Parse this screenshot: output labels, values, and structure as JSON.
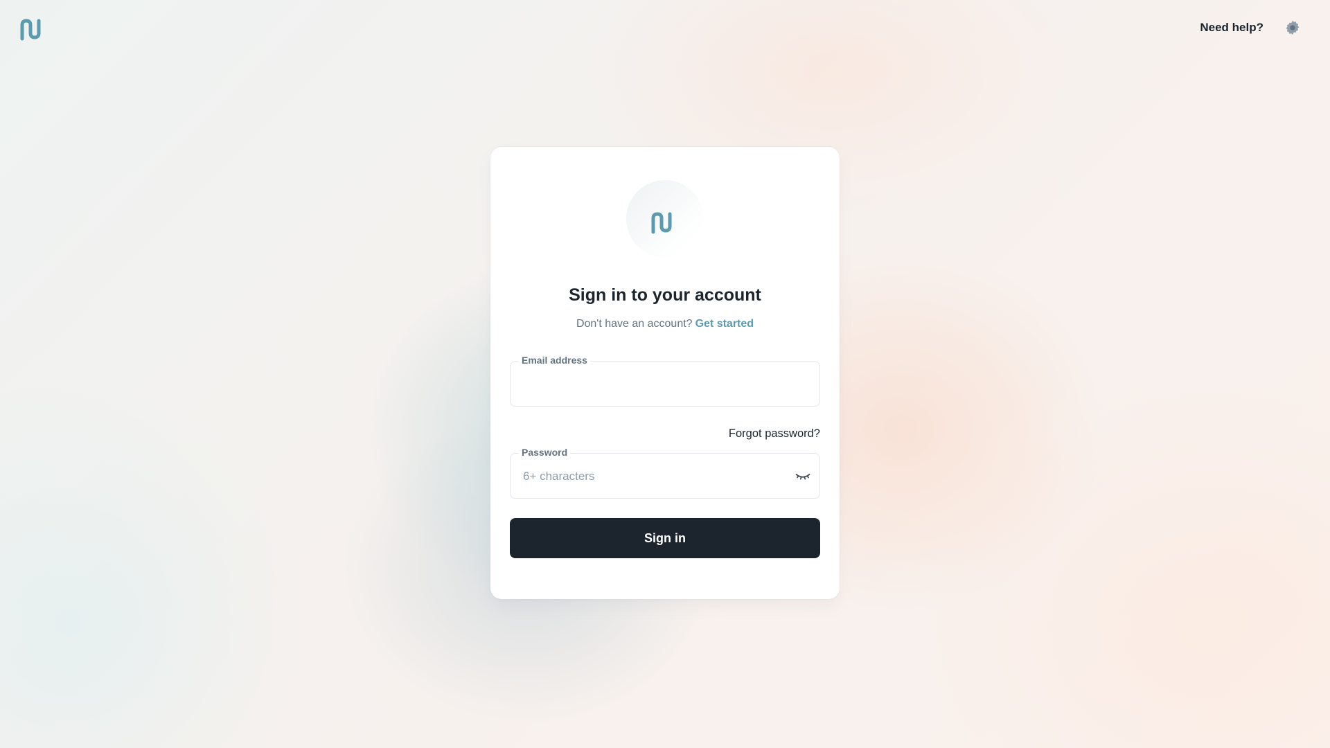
{
  "header": {
    "logo_icon": "brand-logo-icon",
    "help_label": "Need help?",
    "settings_icon": "gear-icon"
  },
  "card": {
    "logo_icon": "brand-logo-icon",
    "title": "Sign in to your account",
    "subtitle_text": "Don't have an account?",
    "subtitle_link": "Get started",
    "email": {
      "label": "Email address",
      "value": "",
      "placeholder": ""
    },
    "forgot_password": "Forgot password?",
    "password": {
      "label": "Password",
      "value": "",
      "placeholder": "6+ characters",
      "toggle_icon": "eye-closed-icon"
    },
    "submit_label": "Sign in"
  },
  "colors": {
    "brand": "#5c9aae",
    "primary_button": "#1c252e",
    "text_primary": "#1c252e",
    "text_secondary": "#637381"
  }
}
